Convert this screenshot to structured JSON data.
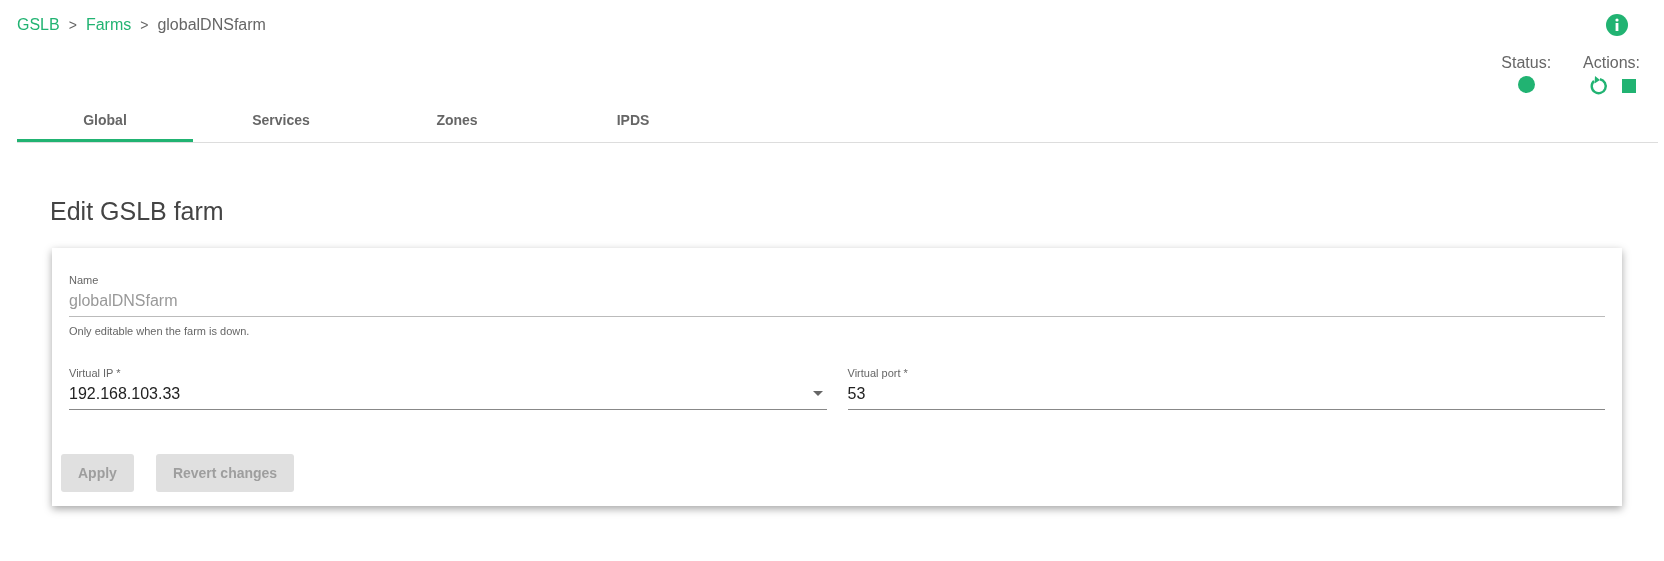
{
  "breadcrumb": [
    {
      "label": "GSLB",
      "kind": "link"
    },
    {
      "label": "Farms",
      "kind": "link"
    },
    {
      "label": "globalDNSfarm",
      "kind": "current"
    }
  ],
  "separator": ">",
  "status": {
    "label": "Status:",
    "running": true
  },
  "actions": {
    "label": "Actions:"
  },
  "tabs": [
    {
      "label": "Global",
      "selected": true
    },
    {
      "label": "Services",
      "selected": false
    },
    {
      "label": "Zones",
      "selected": false
    },
    {
      "label": "IPDS",
      "selected": false
    }
  ],
  "heading": "Edit GSLB farm",
  "name_field": {
    "label": "Name",
    "value": "globalDNSfarm",
    "disabled": true,
    "hint": "Only editable when the farm is down."
  },
  "fields": [
    {
      "label": "Virtual IP *",
      "value": "192.168.103.33",
      "kind": "select"
    },
    {
      "label": "Virtual port *",
      "value": "53",
      "kind": "text"
    }
  ],
  "buttons": [
    {
      "label": "Apply",
      "disabled": true
    },
    {
      "label": "Revert changes",
      "disabled": true
    }
  ]
}
